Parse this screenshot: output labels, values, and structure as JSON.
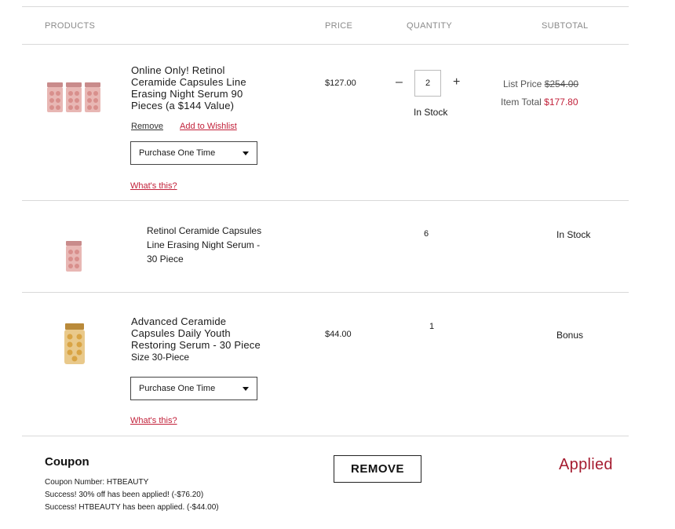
{
  "header": {
    "products": "PRODUCTS",
    "price": "PRICE",
    "quantity": "QUANTITY",
    "subtotal": "SUBTOTAL"
  },
  "items": [
    {
      "title_lines": [
        "Online Only! Retinol",
        "Ceramide Capsules Line",
        "Erasing Night Serum 90",
        "Pieces (a $144 Value)"
      ],
      "remove_label": "Remove",
      "wishlist_label": "Add to Wishlist",
      "purchase_option": "Purchase One Time",
      "whats_this": "What's this?",
      "price": "$127.00",
      "quantity": "2",
      "qty_minus": "–",
      "qty_plus": "+",
      "stock": "In Stock",
      "list_price_label": "List Price",
      "list_price_value": "$254.00",
      "item_total_label": "Item Total",
      "item_total_value": "$177.80",
      "thumb": "retinol-capsules-jars-icon"
    },
    {
      "title_lines": [
        "Retinol Ceramide Capsules",
        "Line Erasing Night Serum -",
        "30 Piece"
      ],
      "quantity": "6",
      "status": "In Stock",
      "thumb": "retinol-capsules-jar-icon"
    },
    {
      "title_lines": [
        "Advanced Ceramide",
        "Capsules Daily Youth",
        "Restoring Serum - 30 Piece"
      ],
      "size": "Size 30-Piece",
      "price": "$44.00",
      "quantity": "1",
      "status": "Bonus",
      "purchase_option": "Purchase One Time",
      "whats_this": "What's this?",
      "thumb": "gold-capsules-jar-icon"
    }
  ],
  "coupon": {
    "title": "Coupon",
    "lines": [
      "Coupon Number: HTBEAUTY",
      "Success! 30% off has been applied! (-$76.20)",
      "Success! HTBEAUTY has been applied. (-$44.00)"
    ],
    "remove_label": "REMOVE",
    "status": "Applied"
  },
  "colors": {
    "accent_red": "#c2213a",
    "applied_red": "#a51c30",
    "rule": "#d9d9d9"
  }
}
